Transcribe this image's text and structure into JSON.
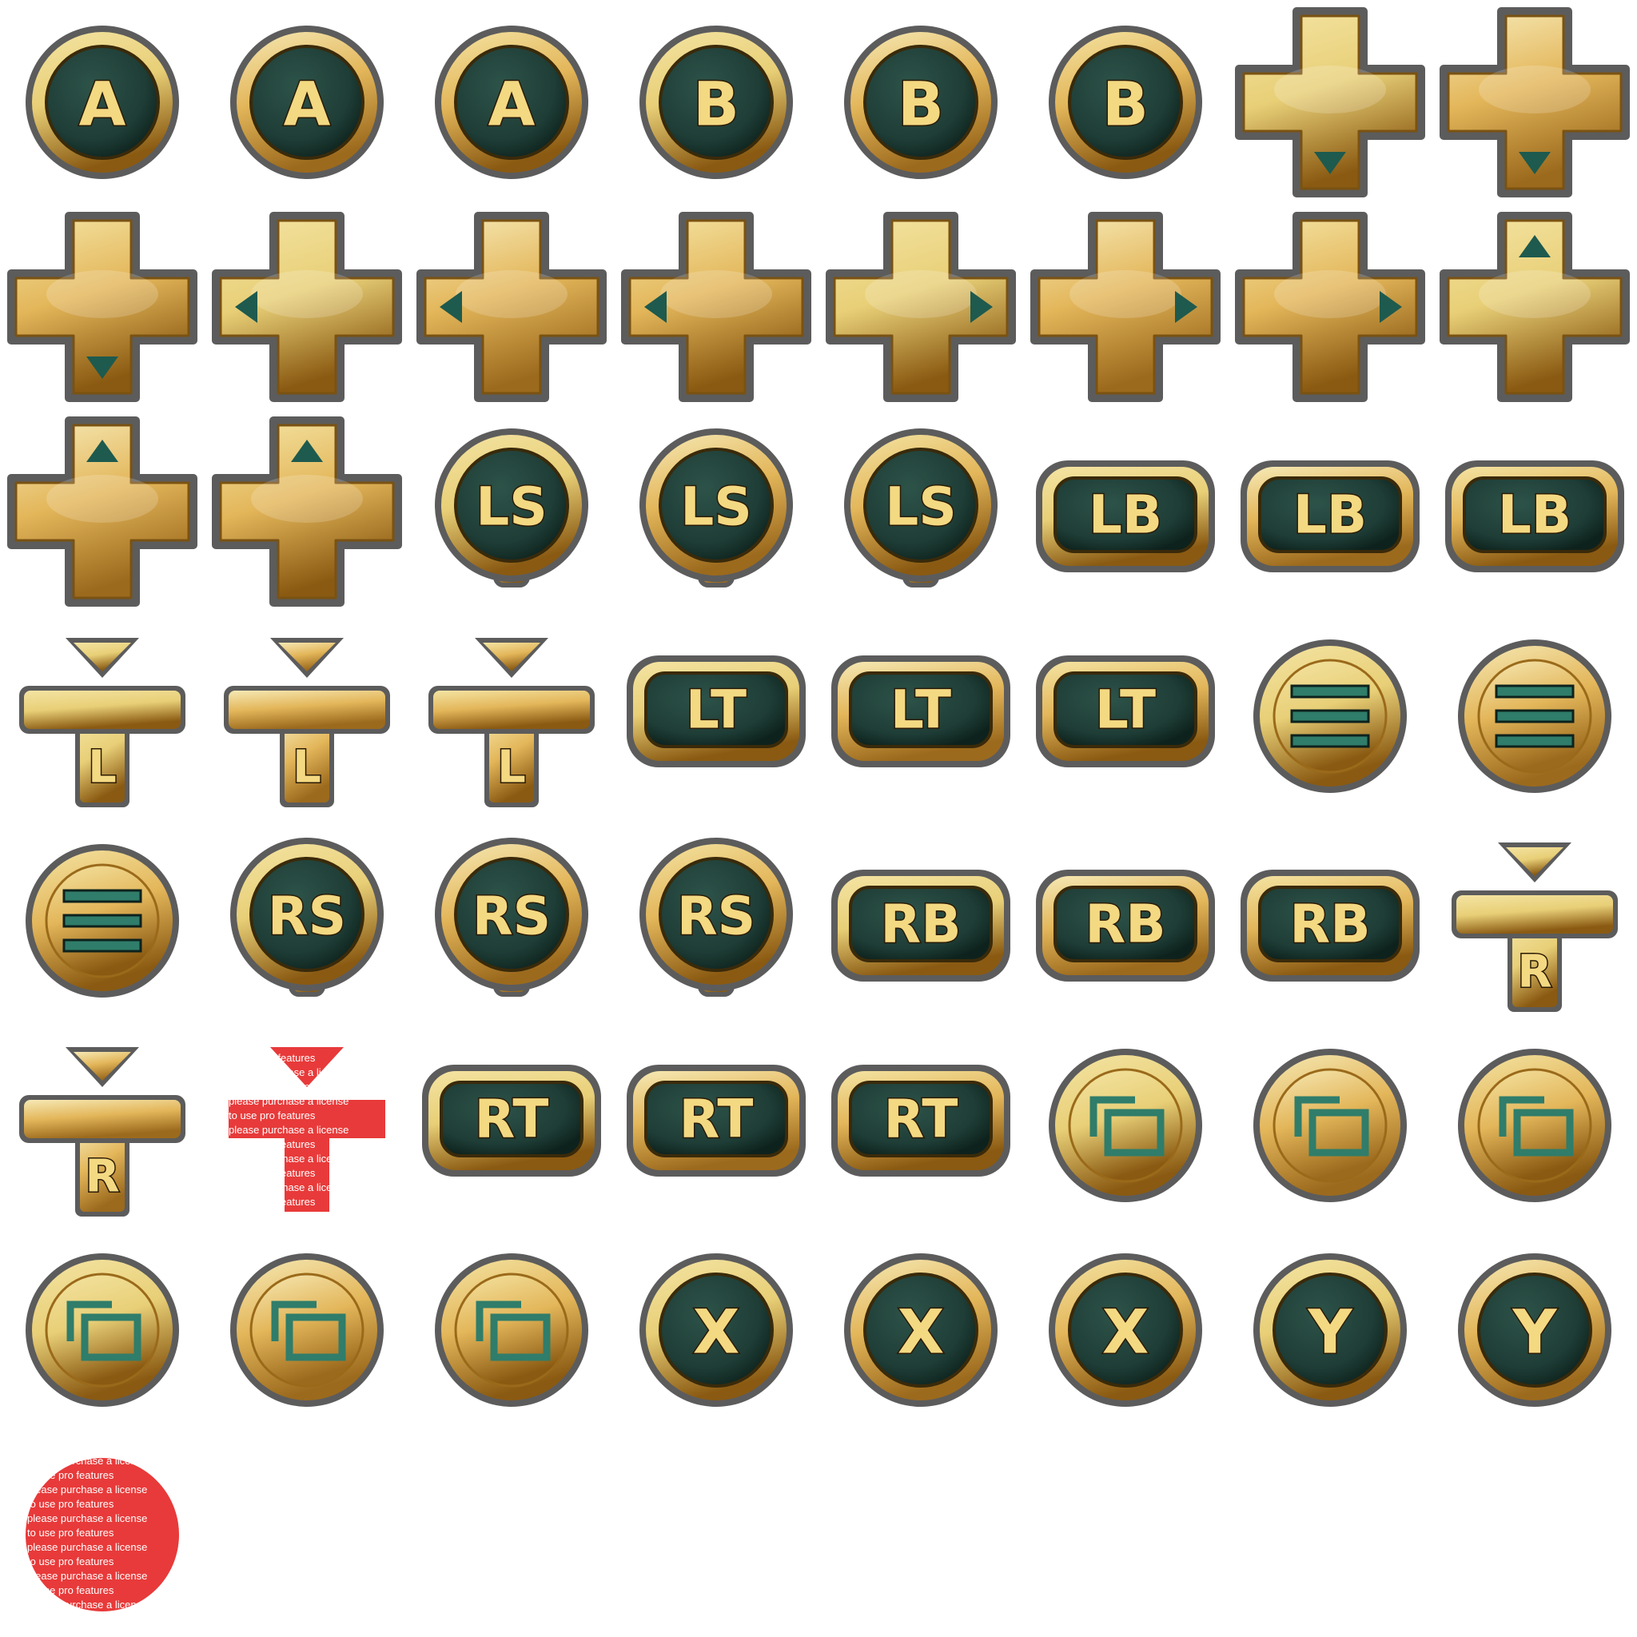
{
  "sheet": {
    "background": "#ffffff",
    "colors": {
      "gold": "#e3b65a",
      "gold_light": "#f4e4a3",
      "gold_dark": "#8a5a12",
      "face": "#1e3d36",
      "face_dark": "#0e221d",
      "teal": "#2f7d6a",
      "outline": "#5c5c5c",
      "watermark": "#e83a3a"
    },
    "icons": [
      {
        "id": "a-1",
        "type": "round",
        "label": "A"
      },
      {
        "id": "a-2",
        "type": "round",
        "label": "A"
      },
      {
        "id": "a-3",
        "type": "round",
        "label": "A"
      },
      {
        "id": "b-1",
        "type": "round",
        "label": "B"
      },
      {
        "id": "b-2",
        "type": "round",
        "label": "B"
      },
      {
        "id": "b-3",
        "type": "round",
        "label": "B"
      },
      {
        "id": "dpad-down-1",
        "type": "dpad",
        "arrow": "down",
        "label": ""
      },
      {
        "id": "dpad-down-2",
        "type": "dpad",
        "arrow": "down",
        "label": ""
      },
      {
        "id": "dpad-down-3",
        "type": "dpad",
        "arrow": "down",
        "label": ""
      },
      {
        "id": "dpad-left-1",
        "type": "dpad",
        "arrow": "left",
        "label": ""
      },
      {
        "id": "dpad-left-2",
        "type": "dpad",
        "arrow": "left",
        "label": ""
      },
      {
        "id": "dpad-left-3",
        "type": "dpad",
        "arrow": "left",
        "label": ""
      },
      {
        "id": "dpad-right-1",
        "type": "dpad",
        "arrow": "right",
        "label": ""
      },
      {
        "id": "dpad-right-2",
        "type": "dpad",
        "arrow": "right",
        "label": ""
      },
      {
        "id": "dpad-right-3",
        "type": "dpad",
        "arrow": "right",
        "label": ""
      },
      {
        "id": "dpad-up-1",
        "type": "dpad",
        "arrow": "up",
        "label": ""
      },
      {
        "id": "dpad-up-2",
        "type": "dpad",
        "arrow": "up",
        "label": ""
      },
      {
        "id": "dpad-up-3",
        "type": "dpad",
        "arrow": "up",
        "label": ""
      },
      {
        "id": "ls-1",
        "type": "stick",
        "label": "LS"
      },
      {
        "id": "ls-2",
        "type": "stick",
        "label": "LS"
      },
      {
        "id": "ls-3",
        "type": "stick",
        "label": "LS"
      },
      {
        "id": "lb-1",
        "type": "bumper",
        "label": "LB"
      },
      {
        "id": "lb-2",
        "type": "bumper",
        "label": "LB"
      },
      {
        "id": "lb-3",
        "type": "bumper",
        "label": "LB"
      },
      {
        "id": "l-stick-press-1",
        "type": "tstick",
        "label": "L"
      },
      {
        "id": "l-stick-press-2",
        "type": "tstick",
        "label": "L"
      },
      {
        "id": "l-stick-press-3",
        "type": "tstick",
        "label": "L"
      },
      {
        "id": "lt-1",
        "type": "trigger",
        "label": "LT"
      },
      {
        "id": "lt-2",
        "type": "trigger",
        "label": "LT"
      },
      {
        "id": "lt-3",
        "type": "trigger",
        "label": "LT"
      },
      {
        "id": "menu-1",
        "type": "menu",
        "label": ""
      },
      {
        "id": "menu-2",
        "type": "menu",
        "label": ""
      },
      {
        "id": "menu-3",
        "type": "menu",
        "label": ""
      },
      {
        "id": "rs-1",
        "type": "stick",
        "label": "RS"
      },
      {
        "id": "rs-2",
        "type": "stick",
        "label": "RS"
      },
      {
        "id": "rs-3",
        "type": "stick",
        "label": "RS"
      },
      {
        "id": "rb-1",
        "type": "bumper",
        "label": "RB"
      },
      {
        "id": "rb-2",
        "type": "bumper",
        "label": "RB"
      },
      {
        "id": "rb-3",
        "type": "bumper",
        "label": "RB"
      },
      {
        "id": "r-stick-press-1",
        "type": "tstick",
        "label": "R"
      },
      {
        "id": "r-stick-press-2",
        "type": "tstick",
        "label": "R"
      },
      {
        "id": "r-stick-press-3",
        "type": "watermark-t",
        "label": ""
      },
      {
        "id": "rt-1",
        "type": "trigger",
        "label": "RT"
      },
      {
        "id": "rt-2",
        "type": "trigger",
        "label": "RT"
      },
      {
        "id": "rt-3",
        "type": "trigger",
        "label": "RT"
      },
      {
        "id": "view-1",
        "type": "view",
        "label": ""
      },
      {
        "id": "view-2",
        "type": "view",
        "label": ""
      },
      {
        "id": "view-3",
        "type": "view",
        "label": ""
      },
      {
        "id": "view-4",
        "type": "view",
        "label": ""
      },
      {
        "id": "view-5",
        "type": "view",
        "label": ""
      },
      {
        "id": "view-6",
        "type": "view",
        "label": ""
      },
      {
        "id": "x-1",
        "type": "round",
        "label": "X"
      },
      {
        "id": "x-2",
        "type": "round",
        "label": "X"
      },
      {
        "id": "x-3",
        "type": "round",
        "label": "X"
      },
      {
        "id": "y-1",
        "type": "round",
        "label": "Y"
      },
      {
        "id": "y-2",
        "type": "round",
        "label": "Y"
      },
      {
        "id": "y-3",
        "type": "watermark-circle",
        "label": ""
      }
    ],
    "watermark": {
      "line1": "please purchase a license",
      "line2": "to use pro features",
      "line3": "features"
    }
  }
}
